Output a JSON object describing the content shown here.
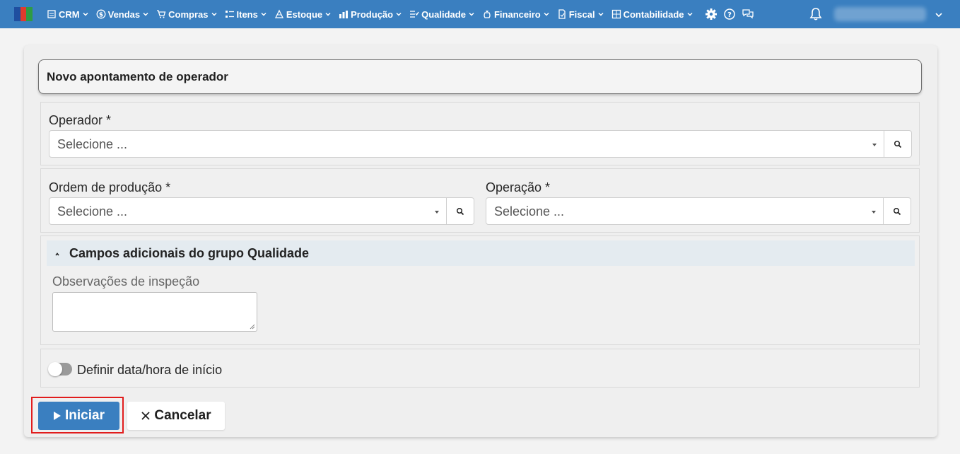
{
  "nav": {
    "menu": [
      {
        "label": "CRM",
        "icon": "crm-icon"
      },
      {
        "label": "Vendas",
        "icon": "dollar-icon"
      },
      {
        "label": "Compras",
        "icon": "cart-icon"
      },
      {
        "label": "Itens",
        "icon": "items-icon"
      },
      {
        "label": "Estoque",
        "icon": "stock-icon"
      },
      {
        "label": "Produção",
        "icon": "production-icon"
      },
      {
        "label": "Qualidade",
        "icon": "quality-icon"
      },
      {
        "label": "Financeiro",
        "icon": "finance-icon"
      },
      {
        "label": "Fiscal",
        "icon": "fiscal-icon"
      },
      {
        "label": "Contabilidade",
        "icon": "accounting-icon"
      }
    ],
    "extra_icons": [
      "gear-icon",
      "help-icon",
      "chat-icon"
    ],
    "colors": {
      "bar": "#3a7fc0",
      "logo": [
        "#1f4fa0",
        "#e03a2d",
        "#2e9b45"
      ]
    }
  },
  "form": {
    "title": "Novo apontamento de operador",
    "operador": {
      "label": "Operador *",
      "placeholder": "Selecione ..."
    },
    "ordem": {
      "label": "Ordem de produção *",
      "placeholder": "Selecione ..."
    },
    "operacao": {
      "label": "Operação *",
      "placeholder": "Selecione ..."
    },
    "quality_group": {
      "title": "Campos adicionais do grupo Qualidade",
      "obs_label": "Observações de inspeção"
    },
    "start_toggle": {
      "label": "Definir data/hora de início",
      "checked": false
    },
    "buttons": {
      "start": "Iniciar",
      "cancel": "Cancelar"
    }
  }
}
